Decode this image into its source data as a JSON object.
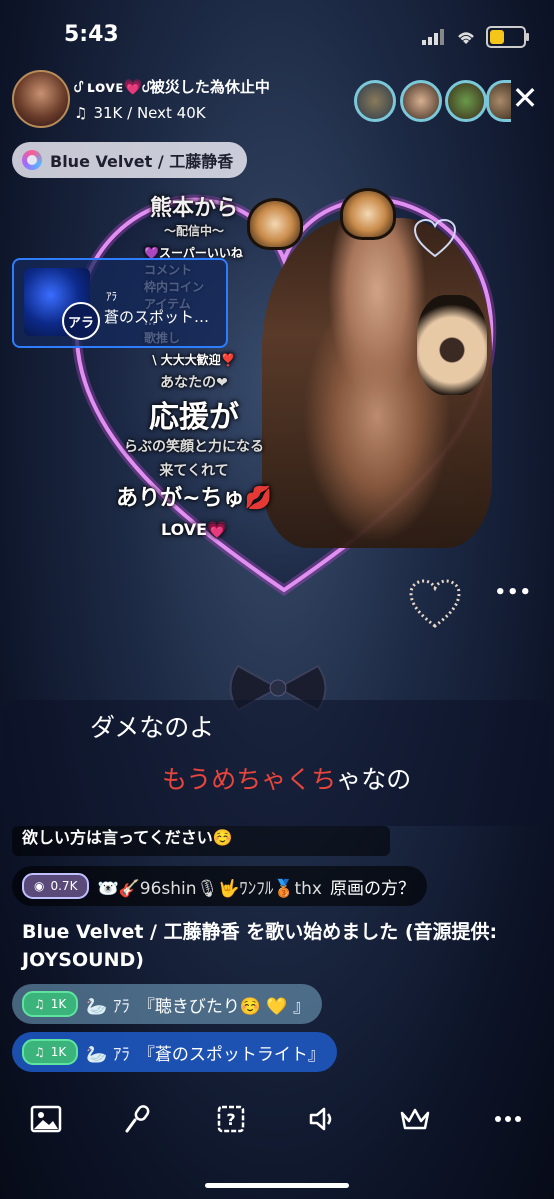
{
  "status_bar": {
    "time": "5:43",
    "battery_level": 0.45,
    "battery_color": "#f5c518"
  },
  "header": {
    "host_title": "ᦔ ʟᴏᴠᴇ💗ᦔ被災した為休止中",
    "stats": "31K / Next 40K",
    "stats_icon": "music-note-icon",
    "close_icon": "close-icon"
  },
  "song_pill": {
    "label": "Blue Velvet / 工藤静香"
  },
  "promo": {
    "city": "熊本から",
    "streaming": "～配信中～",
    "items": [
      "💜スーパーいいね",
      "コメント",
      "枠内コイン",
      "アイテム",
      "…",
      "歌推し"
    ],
    "welcome": "\\ 大大大歓迎❣️",
    "line1": "あなたの❤",
    "line2": "応援が",
    "line3": "らぶの笑顔と力になる",
    "line4": "来てくれて",
    "line5": "ありが~ちゅ💋",
    "love": "LOVE💗"
  },
  "spot_card": {
    "logo": "アラ",
    "label": "ｱﾗ",
    "title": "蒼のスポット…"
  },
  "more_dots": "•••",
  "lyrics": {
    "line1": "ダメなのよ",
    "line2_sung": "もうめちゃくち",
    "line2_unsung": "ゃなの",
    "sung_color": "#e8453c"
  },
  "chat": {
    "cut_message": "欲しい方は言ってください☺️",
    "row1": {
      "badge": "0.7K",
      "name": "🐻‍❄️🎸96shin🎙🤟ﾜﾝﾌﾙ🥉thx",
      "text": "原画の方？"
    },
    "system": "Blue Velvet / 工藤静香 を歌い始めました (音源提供: JOYSOUND)",
    "row2": {
      "badge": "1K",
      "name": "🦢 ｱﾗ",
      "text": "『聴きびたり☺️ 💛 』"
    },
    "row3": {
      "badge": "1K",
      "name": "🦢 ｱﾗ",
      "text": "『蒼のスポットライト』"
    }
  },
  "bottom_bar": {
    "icons": [
      "image-icon",
      "microphone-icon",
      "help-icon",
      "speaker-icon",
      "crown-icon",
      "more-icon"
    ]
  }
}
